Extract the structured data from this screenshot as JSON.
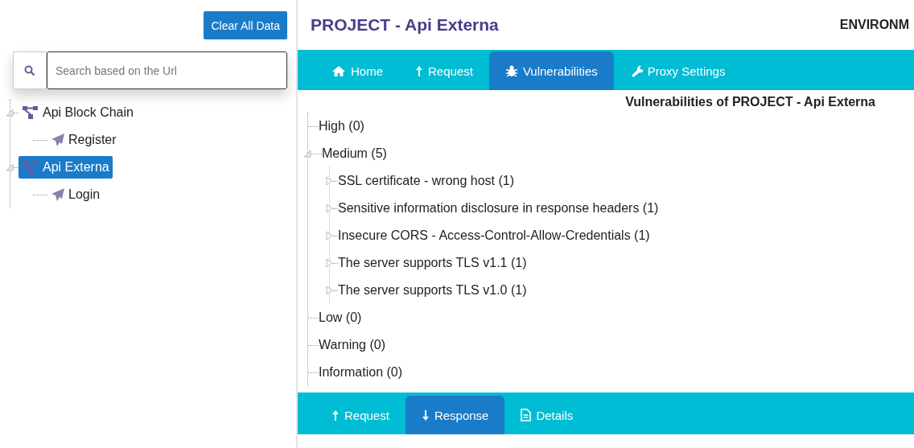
{
  "sidebar": {
    "clear_button": "Clear All Data",
    "search": {
      "placeholder": "Search based on the Url"
    },
    "tree": [
      {
        "label": "Api Block Chain",
        "kind": "project",
        "expanded": true,
        "selected": false,
        "children": [
          {
            "label": "Register",
            "kind": "request",
            "selected": false
          }
        ]
      },
      {
        "label": "Api Externa",
        "kind": "project",
        "expanded": true,
        "selected": true,
        "children": [
          {
            "label": "Login",
            "kind": "request",
            "selected": false
          }
        ]
      }
    ]
  },
  "header": {
    "title": "PROJECT - Api Externa",
    "environment": "ENVIRONM"
  },
  "tabs": [
    {
      "label": "Home",
      "kind": "home",
      "selected": false
    },
    {
      "label": "Request",
      "kind": "upload",
      "selected": false
    },
    {
      "label": "Vulnerabilities",
      "kind": "bug",
      "selected": true
    },
    {
      "label": "Proxy Settings",
      "kind": "settings",
      "selected": false
    }
  ],
  "vulnerabilities": {
    "title": "Vulnerabilities of PROJECT - Api Externa",
    "tree": [
      {
        "label": "High (0)"
      },
      {
        "label": "Medium (5)",
        "expanded": true,
        "children": [
          {
            "label": "SSL certificate - wrong host (1)",
            "expanded": false
          },
          {
            "label": "Sensitive information disclosure in response headers (1)",
            "expanded": false
          },
          {
            "label": "Insecure CORS - Access-Control-Allow-Credentials (1)",
            "expanded": false
          },
          {
            "label": "The server supports TLS v1.1 (1)",
            "expanded": false
          },
          {
            "label": "The server supports TLS v1.0 (1)",
            "expanded": false
          }
        ]
      },
      {
        "label": "Low (0)"
      },
      {
        "label": "Warning (0)"
      },
      {
        "label": "Information (0)"
      }
    ]
  },
  "bottom_tabs": [
    {
      "label": "Request",
      "kind": "upload",
      "selected": false
    },
    {
      "label": "Response",
      "kind": "download",
      "selected": true
    },
    {
      "label": "Details",
      "kind": "details",
      "selected": false
    }
  ]
}
